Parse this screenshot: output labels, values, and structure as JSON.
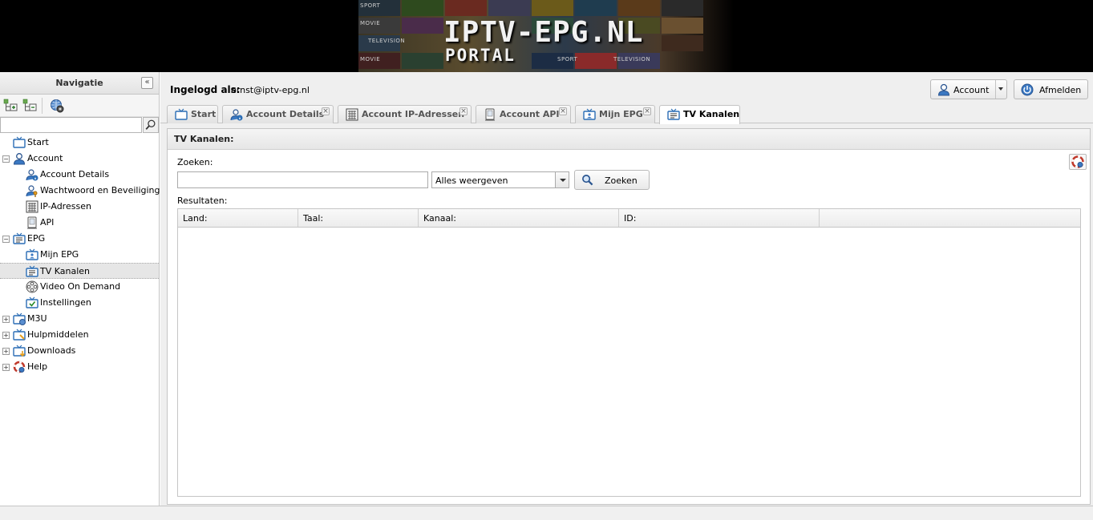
{
  "banner": {
    "title": "IPTV-EPG.NL",
    "subtitle": "PORTAL",
    "thumb_labels": [
      "SPORT",
      "MOVIE",
      "TELEVISION",
      "MOVIE",
      "SPORT",
      "TELEVISION"
    ]
  },
  "sidebar": {
    "title": "Navigatie",
    "collapse_glyph": "«",
    "tree": [
      {
        "label": "Start",
        "icon": "tv-icon",
        "level": 0,
        "expander": ""
      },
      {
        "label": "Account",
        "icon": "user-icon",
        "level": 0,
        "expander": "−"
      },
      {
        "label": "Account Details",
        "icon": "user-info-icon",
        "level": 1,
        "expander": ""
      },
      {
        "label": "Wachtwoord en Beveiliging",
        "icon": "user-key-icon",
        "level": 1,
        "expander": ""
      },
      {
        "label": "IP-Adressen",
        "icon": "network-grid-icon",
        "level": 1,
        "expander": ""
      },
      {
        "label": "API",
        "icon": "device-icon",
        "level": 1,
        "expander": ""
      },
      {
        "label": "EPG",
        "icon": "tv-list-icon",
        "level": 0,
        "expander": "−"
      },
      {
        "label": "Mijn EPG",
        "icon": "tv-user-icon",
        "level": 1,
        "expander": ""
      },
      {
        "label": "TV Kanalen",
        "icon": "tv-list-icon",
        "level": 1,
        "expander": "",
        "selected": true
      },
      {
        "label": "Video On Demand",
        "icon": "film-reel-icon",
        "level": 1,
        "expander": ""
      },
      {
        "label": "Instellingen",
        "icon": "tv-check-icon",
        "level": 1,
        "expander": ""
      },
      {
        "label": "M3U",
        "icon": "tv-globe-icon",
        "level": 0,
        "expander": "+"
      },
      {
        "label": "Hulpmiddelen",
        "icon": "tv-tools-icon",
        "level": 0,
        "expander": "+"
      },
      {
        "label": "Downloads",
        "icon": "tv-download-icon",
        "level": 0,
        "expander": "+"
      },
      {
        "label": "Help",
        "icon": "help-lifebuoy-icon",
        "level": 0,
        "expander": "+"
      }
    ]
  },
  "topbar": {
    "login_label": "Ingelogd als:",
    "login_user": "ernst@iptv-epg.nl",
    "account_button": "Account",
    "logout_button": "Afmelden"
  },
  "tabs": [
    {
      "label": "Start",
      "icon": "tv-icon",
      "closable": false,
      "active": false
    },
    {
      "label": "Account Details",
      "icon": "user-info-icon",
      "closable": true,
      "active": false
    },
    {
      "label": "Account IP-Adressen",
      "icon": "network-grid-icon",
      "closable": true,
      "active": false
    },
    {
      "label": "Account API",
      "icon": "device-icon",
      "closable": true,
      "active": false
    },
    {
      "label": "Mijn EPG",
      "icon": "tv-user-icon",
      "closable": true,
      "active": false
    },
    {
      "label": "TV Kanalen",
      "icon": "tv-list-icon",
      "closable": false,
      "active": true
    }
  ],
  "panel": {
    "title": "TV Kanalen:",
    "search_label": "Zoeken:",
    "search_value": "",
    "filter_selected": "Alles weergeven",
    "search_button": "Zoeken",
    "results_label": "Resultaten:",
    "columns": [
      "Land:",
      "Taal:",
      "Kanaal:",
      "ID:",
      ""
    ],
    "rows": []
  },
  "colors": {
    "tv_blue": "#2a6db5",
    "user_blue": "#3a78c2",
    "accent_orange": "#e8a020"
  }
}
